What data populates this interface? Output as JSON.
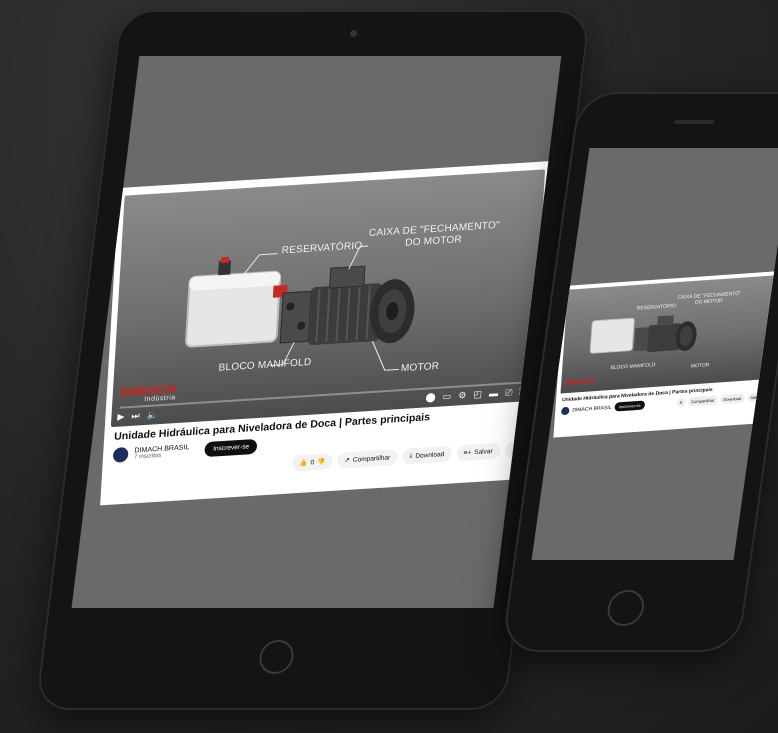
{
  "video": {
    "callouts": {
      "reservoir": "RESERVATÓRIO",
      "motor_cover": "CAIXA DE \"FECHAMENTO\"\nDO MOTOR",
      "manifold": "BLOCO MANIFOLD",
      "motor": "MOTOR"
    },
    "brand": "DIMACH",
    "brand_sub": "Indústria",
    "progress": 0.0,
    "control_icons": [
      "play-icon",
      "next-icon",
      "volume-icon",
      "autoplay-toggle",
      "subtitles-icon",
      "settings-icon",
      "miniplayer-icon",
      "theater-icon",
      "cast-icon",
      "fullscreen-icon"
    ]
  },
  "meta": {
    "title": "Unidade Hidráulica para Niveladora de Doca | Partes principais",
    "channel": "DIMACH BRASIL",
    "subscribers": "7 inscritos",
    "subscribe_label": "Inscrever-se",
    "likes": "0",
    "share_label": "Compartilhar",
    "download_label": "Download",
    "save_label": "Salvar",
    "more_label": "..."
  },
  "colors": {
    "brand": "#d21f1f",
    "screen_bg": "#6a6a6a",
    "device_body": "#141414"
  }
}
